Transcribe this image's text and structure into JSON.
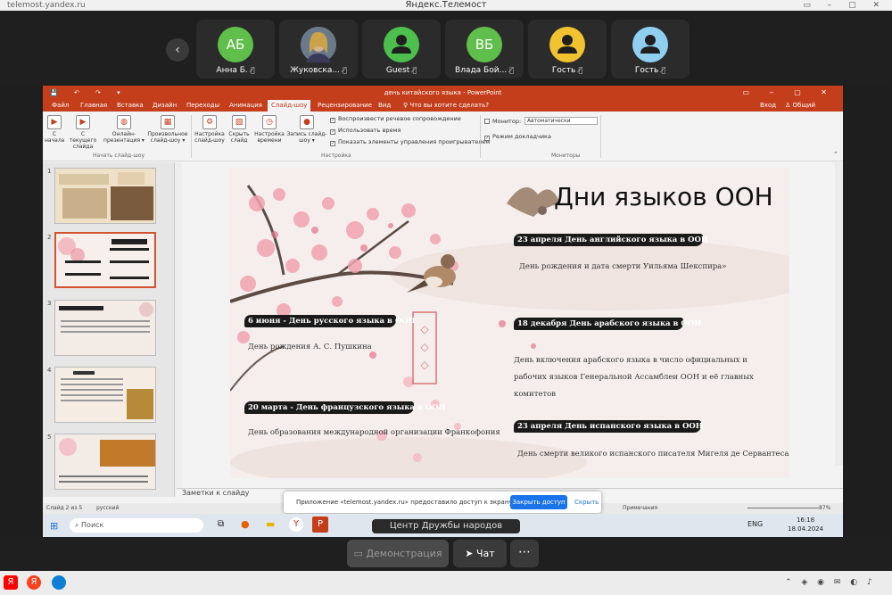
{
  "browser": {
    "url": "telemost.yandex.ru",
    "window_title": "Яндекс.Телемост",
    "controls": "▭ – ▢ ✕"
  },
  "meeting": {
    "back_icon": "‹",
    "participants": [
      {
        "initials": "АБ",
        "name": "Анна Б.",
        "color": "#5fbf4a"
      },
      {
        "initials": "",
        "name": "Жуковска...",
        "color": "#a07860"
      },
      {
        "initials": "",
        "name": "Guest",
        "color": "#4cbf4c"
      },
      {
        "initials": "ВБ",
        "name": "Влада Бой...",
        "color": "#5fbf4a"
      },
      {
        "initials": "",
        "name": "Гость",
        "color": "#f2c330"
      },
      {
        "initials": "",
        "name": "Гость",
        "color": "#8fd0f0"
      }
    ],
    "mic_icon": "🎙̸",
    "center_label": "Центр Дружбы народов",
    "demo_label": "Демонстрация",
    "chat_label": "Чат",
    "more_label": "⋯"
  },
  "ppt": {
    "doc_title": "день китайского языка - PowerPoint",
    "qa": "💾 ↶ ↷ ▾",
    "win": "▭ ‒ ▢ ✕",
    "tabs": [
      "Файл",
      "Главная",
      "Вставка",
      "Дизайн",
      "Переходы",
      "Анимация",
      "Слайд-шоу",
      "Рецензирование",
      "Вид",
      "♀ Что вы хотите сделать?"
    ],
    "signin": "Вход",
    "share": "Общий доступ",
    "ribbon": {
      "btn_start": "С начала",
      "btn_current": "С текущего слайда",
      "btn_online": "Онлайн-презентация ▾",
      "btn_custom": "Произвольное слайд-шоу ▾",
      "btn_setup": "Настройка слайд-шоу",
      "btn_hide": "Скрыть слайд",
      "btn_timing": "Настройка времени",
      "btn_record": "Запись слайд-шоу ▾",
      "chk_narration": "Воспроизвести речевое сопровождение",
      "chk_timings": "Использовать время",
      "chk_media": "Показать элементы управления проигрывателем",
      "monitor_label": "Монитор:",
      "monitor_value": "Автоматически",
      "chk_presenter": "Режим докладчика",
      "grp_start": "Начать слайд-шоу",
      "grp_setup": "Настройка",
      "grp_monitors": "Мониторы"
    },
    "thumb_numbers": [
      "1",
      "2",
      "3",
      "4",
      "5"
    ],
    "slide": {
      "title": "Дни языков ООН",
      "english_head": "23 апреля День английского языка в ООН",
      "english_text": "День рождения и дата смерти Уильяма Шекспира»",
      "russian_head": "6 июня - День русского языка в ООН",
      "russian_text": "День рождения А. С. Пушкина",
      "arabic_head": "18 декабря День арабского языка в ООН",
      "arabic_text1": "День включения арабского языка в число официальных и",
      "arabic_text2": "рабочих языков Генеральной Ассамблеи ООН и её главных",
      "arabic_text3": "комитетов",
      "french_head": "20 марта - День французского языка в ООН",
      "french_text": "День образования международной организации Франкофония",
      "spanish_head": "23 апреля День испанского языка в ООН",
      "spanish_text": "День смерти великого испанского писателя Мигеля де Сервантеса"
    },
    "notes": "Заметки к слайду",
    "status_slide": "Слайд 2 из 5",
    "status_lang": "русский",
    "status_comments": "Примечания",
    "zoom": "87%"
  },
  "banner": {
    "text": "Приложение «telemost.yandex.ru» предоставило доступ к экрану и аудио.",
    "stop": "Закрыть доступ",
    "hide": "Скрыть"
  },
  "taskbar": {
    "search": "Поиск",
    "lang": "ENG",
    "time": "16:18",
    "date": "18.04.2024"
  }
}
